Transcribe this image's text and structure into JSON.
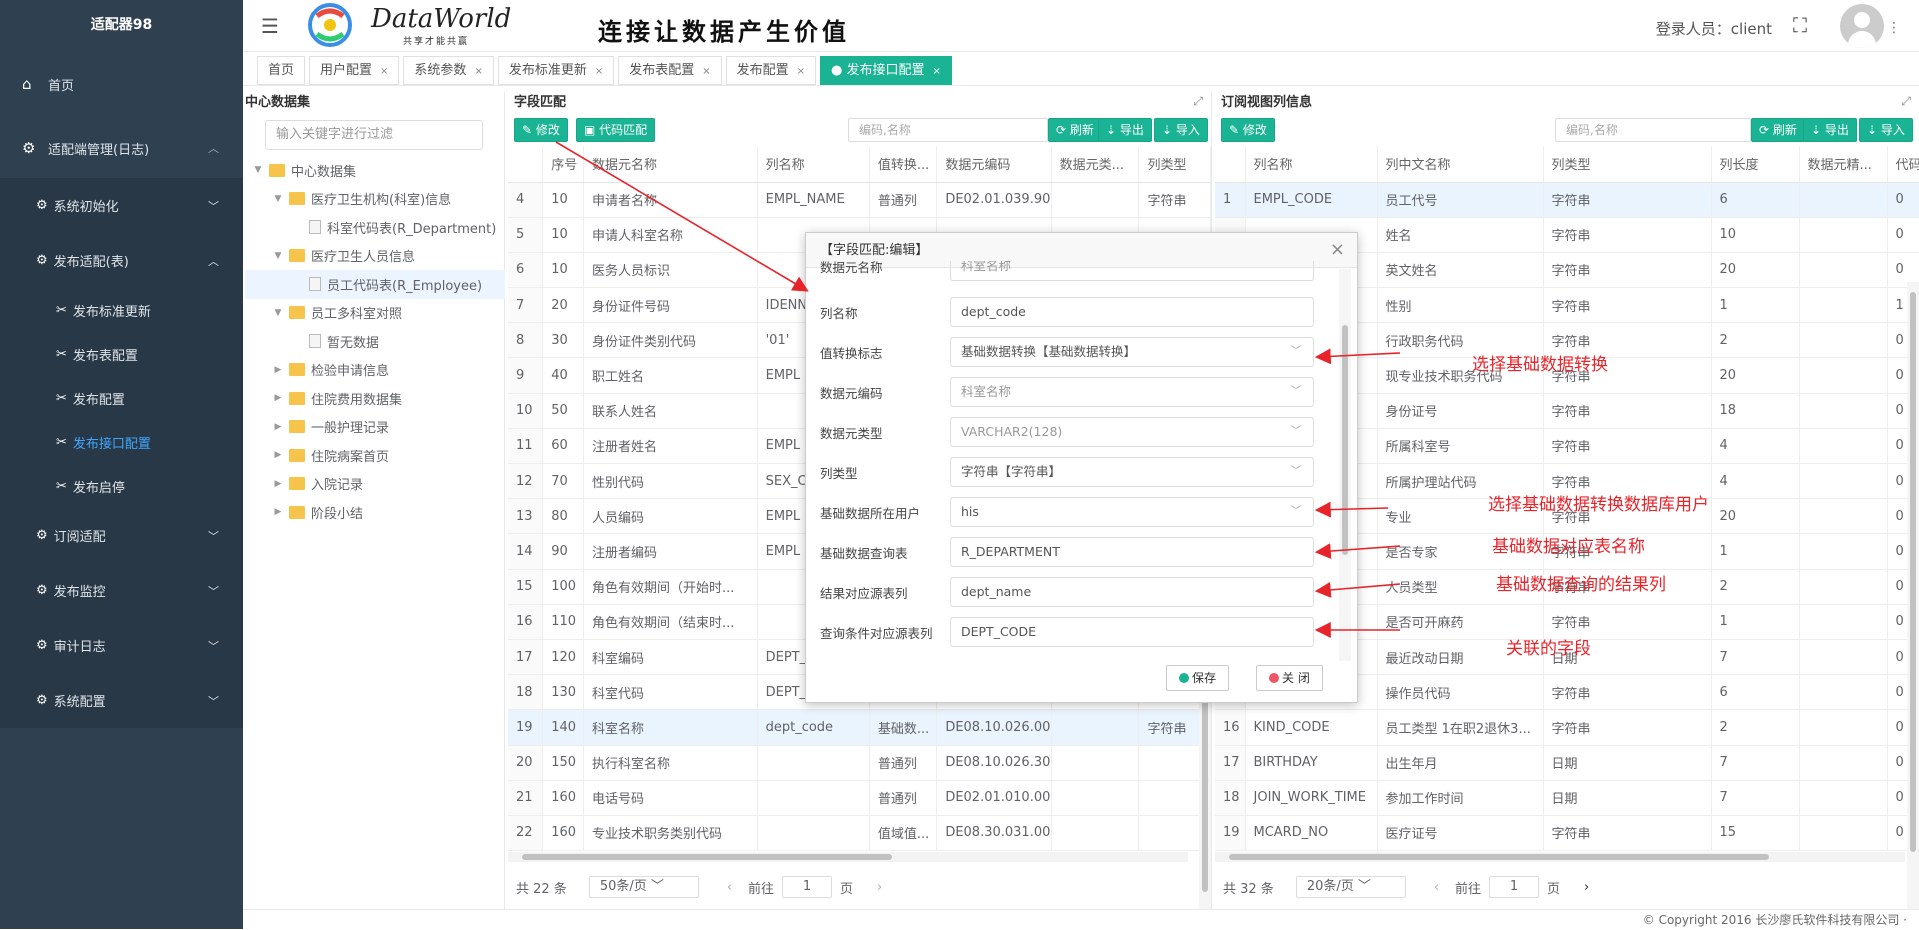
{
  "app": {
    "title": "适配器98"
  },
  "header": {
    "logo_text": "DataWorld",
    "logo_sub": "共享才能共赢",
    "slogan": "连接让数据产生价值",
    "login_label": "登录人员：client"
  },
  "sidebar": {
    "home": "首页",
    "adapter_mgmt": "适配端管理(日志)",
    "sys_init": "系统初始化",
    "publish_adapter": "发布适配(表)",
    "leaves": [
      "发布标准更新",
      "发布表配置",
      "发布配置",
      "发布接口配置",
      "发布启停"
    ],
    "subscribe": "订阅适配",
    "monitor": "发布监控",
    "audit": "审计日志",
    "sys_config": "系统配置"
  },
  "tabs": [
    "首页",
    "用户配置",
    "系统参数",
    "发布标准更新",
    "发布表配置",
    "发布配置",
    "发布接口配置"
  ],
  "tree": {
    "title": "中心数据集",
    "search_placeholder": "输入关键字进行过滤",
    "nodes": [
      {
        "label": "中心数据集"
      },
      {
        "label": "医疗卫生机构(科室)信息"
      },
      {
        "label": "科室代码表(R_Department)"
      },
      {
        "label": "医疗卫生人员信息"
      },
      {
        "label": "员工代码表(R_Employee)"
      },
      {
        "label": "员工多科室对照"
      },
      {
        "label": "暂无数据"
      },
      {
        "label": "检验申请信息"
      },
      {
        "label": "住院费用数据集"
      },
      {
        "label": "一般护理记录"
      },
      {
        "label": "住院病案首页"
      },
      {
        "label": "入院记录"
      },
      {
        "label": "阶段小结"
      }
    ]
  },
  "field_match": {
    "title": "字段匹配",
    "btn_edit": "修改",
    "btn_code": "代码匹配",
    "search_placeholder": "编码,名称",
    "btn_refresh": "刷新",
    "btn_export": "导出",
    "btn_import": "导入",
    "columns": [
      "",
      "序号",
      "数据元名称",
      "列名称",
      "值转换...",
      "数据元编码",
      "数据元类...",
      "列类型"
    ],
    "rows": [
      [
        "4",
        "10",
        "申请者名称",
        "EMPL_NAME",
        "普通列",
        "DE02.01.039.90",
        "",
        "字符串"
      ],
      [
        "5",
        "10",
        "申请人科室名称",
        "",
        "",
        "",
        "",
        ""
      ],
      [
        "6",
        "10",
        "医务人员标识",
        "",
        "",
        "",
        "",
        ""
      ],
      [
        "7",
        "20",
        "身份证件号码",
        "IDENN",
        "",
        "",
        "",
        ""
      ],
      [
        "8",
        "30",
        "身份证件类别代码",
        "'01'",
        "",
        "",
        "",
        ""
      ],
      [
        "9",
        "40",
        "职工姓名",
        "EMPL",
        "",
        "",
        "",
        ""
      ],
      [
        "10",
        "50",
        "联系人姓名",
        "",
        "",
        "",
        "",
        ""
      ],
      [
        "11",
        "60",
        "注册者姓名",
        "EMPL",
        "",
        "",
        "",
        ""
      ],
      [
        "12",
        "70",
        "性别代码",
        "SEX_C",
        "",
        "",
        "",
        ""
      ],
      [
        "13",
        "80",
        "人员编码",
        "EMPL",
        "",
        "",
        "",
        ""
      ],
      [
        "14",
        "90",
        "注册者编码",
        "EMPL",
        "",
        "",
        "",
        ""
      ],
      [
        "15",
        "100",
        "角色有效期间（开始时...",
        "",
        "",
        "",
        "",
        ""
      ],
      [
        "16",
        "110",
        "角色有效期间（结束时...",
        "",
        "",
        "",
        "",
        ""
      ],
      [
        "17",
        "120",
        "科室编码",
        "DEPT_",
        "",
        "",
        "",
        ""
      ],
      [
        "18",
        "130",
        "科室代码",
        "DEPT_",
        "",
        "",
        "",
        ""
      ],
      [
        "19",
        "140",
        "科室名称",
        "dept_code",
        "基础数...",
        "DE08.10.026.00",
        "",
        "字符串"
      ],
      [
        "20",
        "150",
        "执行科室名称",
        "",
        "普通列",
        "DE08.10.026.30",
        "",
        ""
      ],
      [
        "21",
        "160",
        "电话号码",
        "",
        "普通列",
        "DE02.01.010.00",
        "",
        ""
      ],
      [
        "22",
        "160",
        "专业技术职务类别代码",
        "",
        "值域值...",
        "DE08.30.031.00",
        "",
        ""
      ]
    ],
    "total": "共 22 条",
    "page_size": "50条/页",
    "goto_label": "前往",
    "page": "1",
    "page_unit": "页"
  },
  "subscribe_view": {
    "title": "订阅视图列信息",
    "btn_edit": "修改",
    "search_placeholder": "编码,名称",
    "btn_refresh": "刷新",
    "btn_export": "导出",
    "btn_import": "导入",
    "columns": [
      "",
      "列名称",
      "列中文名称",
      "列类型",
      "列长度",
      "数据元精...",
      "代码"
    ],
    "rows": [
      [
        "1",
        "EMPL_CODE",
        "员工代号",
        "字符串",
        "6",
        "",
        "0"
      ],
      [
        "",
        "",
        "姓名",
        "字符串",
        "10",
        "",
        "0"
      ],
      [
        "",
        "",
        "英文姓名",
        "字符串",
        "20",
        "",
        "0"
      ],
      [
        "",
        "",
        "性别",
        "字符串",
        "1",
        "",
        "1"
      ],
      [
        "",
        "",
        "行政职务代码",
        "字符串",
        "2",
        "",
        "0"
      ],
      [
        "",
        "",
        "现专业技术职务代码",
        "字符串",
        "20",
        "",
        "0"
      ],
      [
        "",
        "",
        "身份证号",
        "字符串",
        "18",
        "",
        "0"
      ],
      [
        "",
        "",
        "所属科室号",
        "字符串",
        "4",
        "",
        "0"
      ],
      [
        "",
        "",
        "所属护理站代码",
        "字符串",
        "4",
        "",
        "0"
      ],
      [
        "",
        "",
        "专业",
        "字符串",
        "20",
        "",
        "0"
      ],
      [
        "",
        "",
        "是否专家",
        "字符串",
        "1",
        "",
        "0"
      ],
      [
        "",
        "",
        "人员类型",
        "字符串",
        "2",
        "",
        "0"
      ],
      [
        "",
        "",
        "是否可开麻药",
        "字符串",
        "1",
        "",
        "0"
      ],
      [
        "",
        "",
        "最近改动日期",
        "日期",
        "7",
        "",
        "0"
      ],
      [
        "",
        "",
        "操作员代码",
        "字符串",
        "6",
        "",
        "0"
      ],
      [
        "16",
        "KIND_CODE",
        "员工类型 1在职2退休3...",
        "字符串",
        "2",
        "",
        "0"
      ],
      [
        "17",
        "BIRTHDAY",
        "出生年月",
        "日期",
        "7",
        "",
        "0"
      ],
      [
        "18",
        "JOIN_WORK_TIME",
        "参加工作时间",
        "日期",
        "7",
        "",
        "0"
      ],
      [
        "19",
        "MCARD_NO",
        "医疗证号",
        "字符串",
        "15",
        "",
        "0"
      ]
    ],
    "total": "共 32 条",
    "page_size": "20条/页",
    "goto_label": "前往",
    "page": "1",
    "page_unit": "页"
  },
  "modal": {
    "title": "【字段匹配:编辑】",
    "fields": [
      {
        "label": "数据元名称",
        "value": "科室名称"
      },
      {
        "label": "列名称",
        "value": "dept_code"
      },
      {
        "label": "值转换标志",
        "value": "基础数据转换【基础数据转换】"
      },
      {
        "label": "数据元编码",
        "value": "科室名称"
      },
      {
        "label": "数据元类型",
        "value": "VARCHAR2(128)"
      },
      {
        "label": "列类型",
        "value": "字符串【字符串】"
      },
      {
        "label": "基础数据所在用户",
        "value": "his"
      },
      {
        "label": "基础数据查询表",
        "value": "R_DEPARTMENT"
      },
      {
        "label": "结果对应源表列",
        "value": "dept_name"
      },
      {
        "label": "查询条件对应源表列",
        "value": "DEPT_CODE"
      }
    ],
    "btn_save": "保存",
    "btn_close": "关 闭"
  },
  "annotations": [
    "选择基础数据转换",
    "选择基础数据转换数据库用户",
    "基础数据对应表名称",
    "基础数据查询的结果列",
    "关联的字段"
  ],
  "footer": "© Copyright 2016 长沙廖氏软件科技有限公司 ·",
  "colors": {
    "sidebar_bg": "#2f4050",
    "accent": "#1ab394",
    "annotation": "#e8242b",
    "active_link": "#3ea8ff"
  }
}
